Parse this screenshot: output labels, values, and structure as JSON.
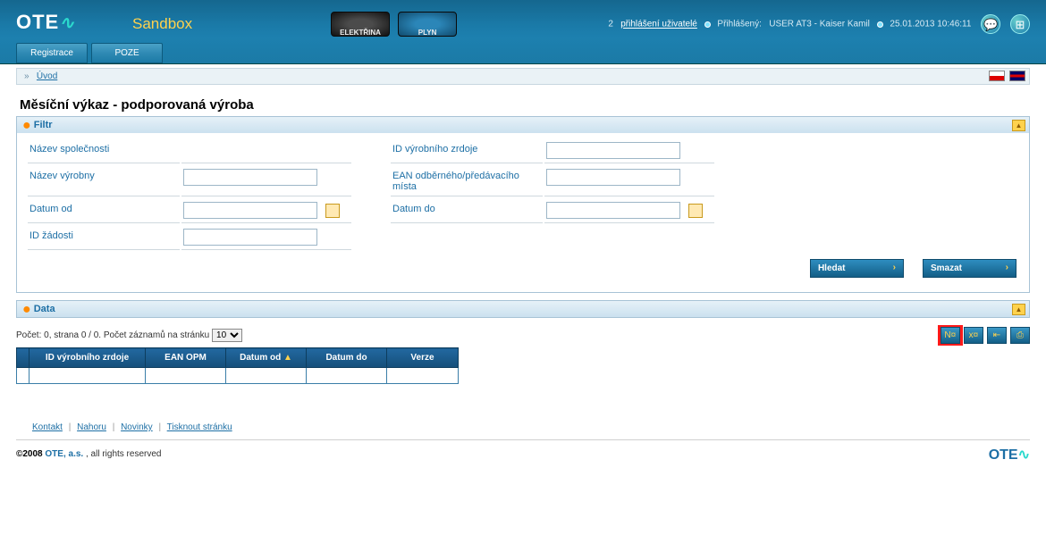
{
  "header": {
    "logo_text": "OTE",
    "sandbox": "Sandbox",
    "products": {
      "electricity": "ELEKTŘINA",
      "gas": "PLYN"
    },
    "logged_users_count": "2",
    "logged_users_label": "přihlášení uživatelé",
    "logged_in_label": "Přihlášený:",
    "logged_in_user": "USER AT3 - Kaiser Kamil",
    "timestamp": "25.01.2013 10:46:11"
  },
  "nav": {
    "registrace": "Registrace",
    "poze": "POZE"
  },
  "breadcrumb": {
    "home": "Úvod"
  },
  "page": {
    "title": "Měsíční výkaz - podporovaná výroba"
  },
  "filter": {
    "panel_title": "Filtr",
    "labels": {
      "company_name": "Název společnosti",
      "source_id": "ID výrobního zrdoje",
      "plant_name": "Název výrobny",
      "ean": "EAN odběrného/předávacího místa",
      "date_from": "Datum od",
      "date_to": "Datum do",
      "request_id": "ID žádosti"
    },
    "values": {
      "company_name": "",
      "source_id": "",
      "plant_name": "",
      "ean": "",
      "date_from": "",
      "date_to": "",
      "request_id": ""
    },
    "buttons": {
      "search": "Hledat",
      "clear": "Smazat"
    }
  },
  "data_panel": {
    "panel_title": "Data",
    "meta_prefix": "Počet: 0, strana 0 / 0. Počet záznamů na stránku",
    "page_size": "10",
    "columns": {
      "source_id": "ID výrobního zrdoje",
      "ean_opm": "EAN OPM",
      "date_from": "Datum od",
      "date_to": "Datum do",
      "version": "Verze"
    }
  },
  "footer": {
    "links": {
      "contact": "Kontakt",
      "up": "Nahoru",
      "news": "Novinky",
      "print": "Tisknout stránku"
    },
    "copyright_prefix": "©2008 ",
    "copyright_company": "OTE, a.s.",
    "copyright_suffix": ", all rights reserved"
  }
}
